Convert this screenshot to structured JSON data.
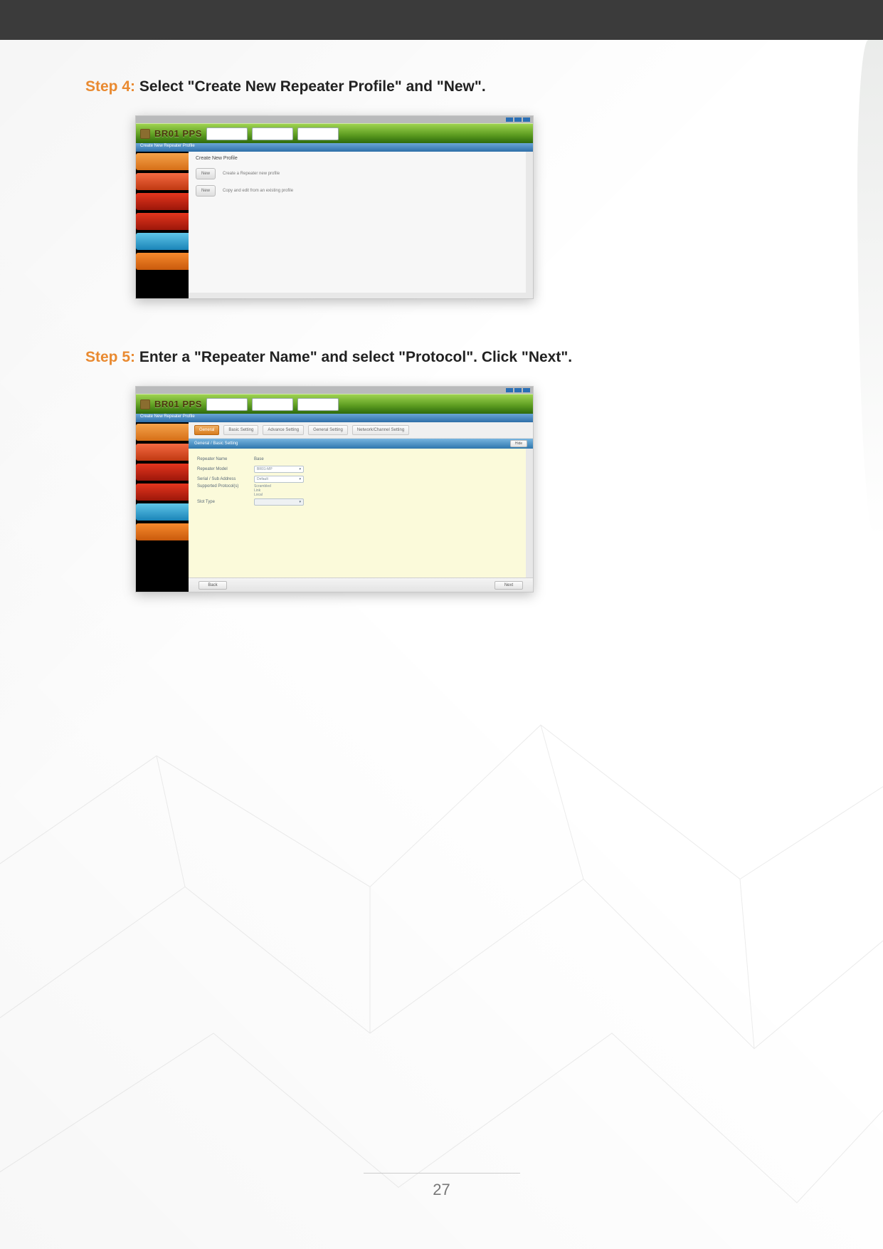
{
  "page_number": "27",
  "step4": {
    "label": "Step 4:",
    "text": " Select \"Create New Repeater Profile\" and \"New\"."
  },
  "step5": {
    "label": "Step 5:",
    "text": " Enter a \"Repeater Name\" and select \"Protocol\". Click \"Next\"."
  },
  "app": {
    "logo_text": "BR01 PPS",
    "ribbon_label": "Create New Repeater Profile",
    "panel_head": "Create New Profile",
    "new_button": "New",
    "opt1_desc": "Create a Repeater new profile",
    "opt2_desc": "Copy and edit from an existing profile",
    "hide": "Hide",
    "tabs": {
      "t0": "General",
      "t1": "Basic Setting",
      "t2": "Advance Setting",
      "t3": "General Setting",
      "t4": "Network/Channel Setting"
    },
    "sec_title": "General / Basic Setting",
    "form": {
      "repeater_name_label": "Repeater Name",
      "repeater_name_value": "Base",
      "repeater_model_label": "Repeater Model",
      "repeater_model_value": "BR01-MP",
      "serial_label": "Serial / Sub Address",
      "serial_value": "Default",
      "protocol_label": "Supported Protocol(s)",
      "protocol_1": "Scrambled",
      "protocol_2": "Link",
      "protocol_3": "Local",
      "slot_label": "Slot Type",
      "slot_value": ""
    },
    "footer": {
      "back": "Back",
      "next": "Next"
    }
  }
}
